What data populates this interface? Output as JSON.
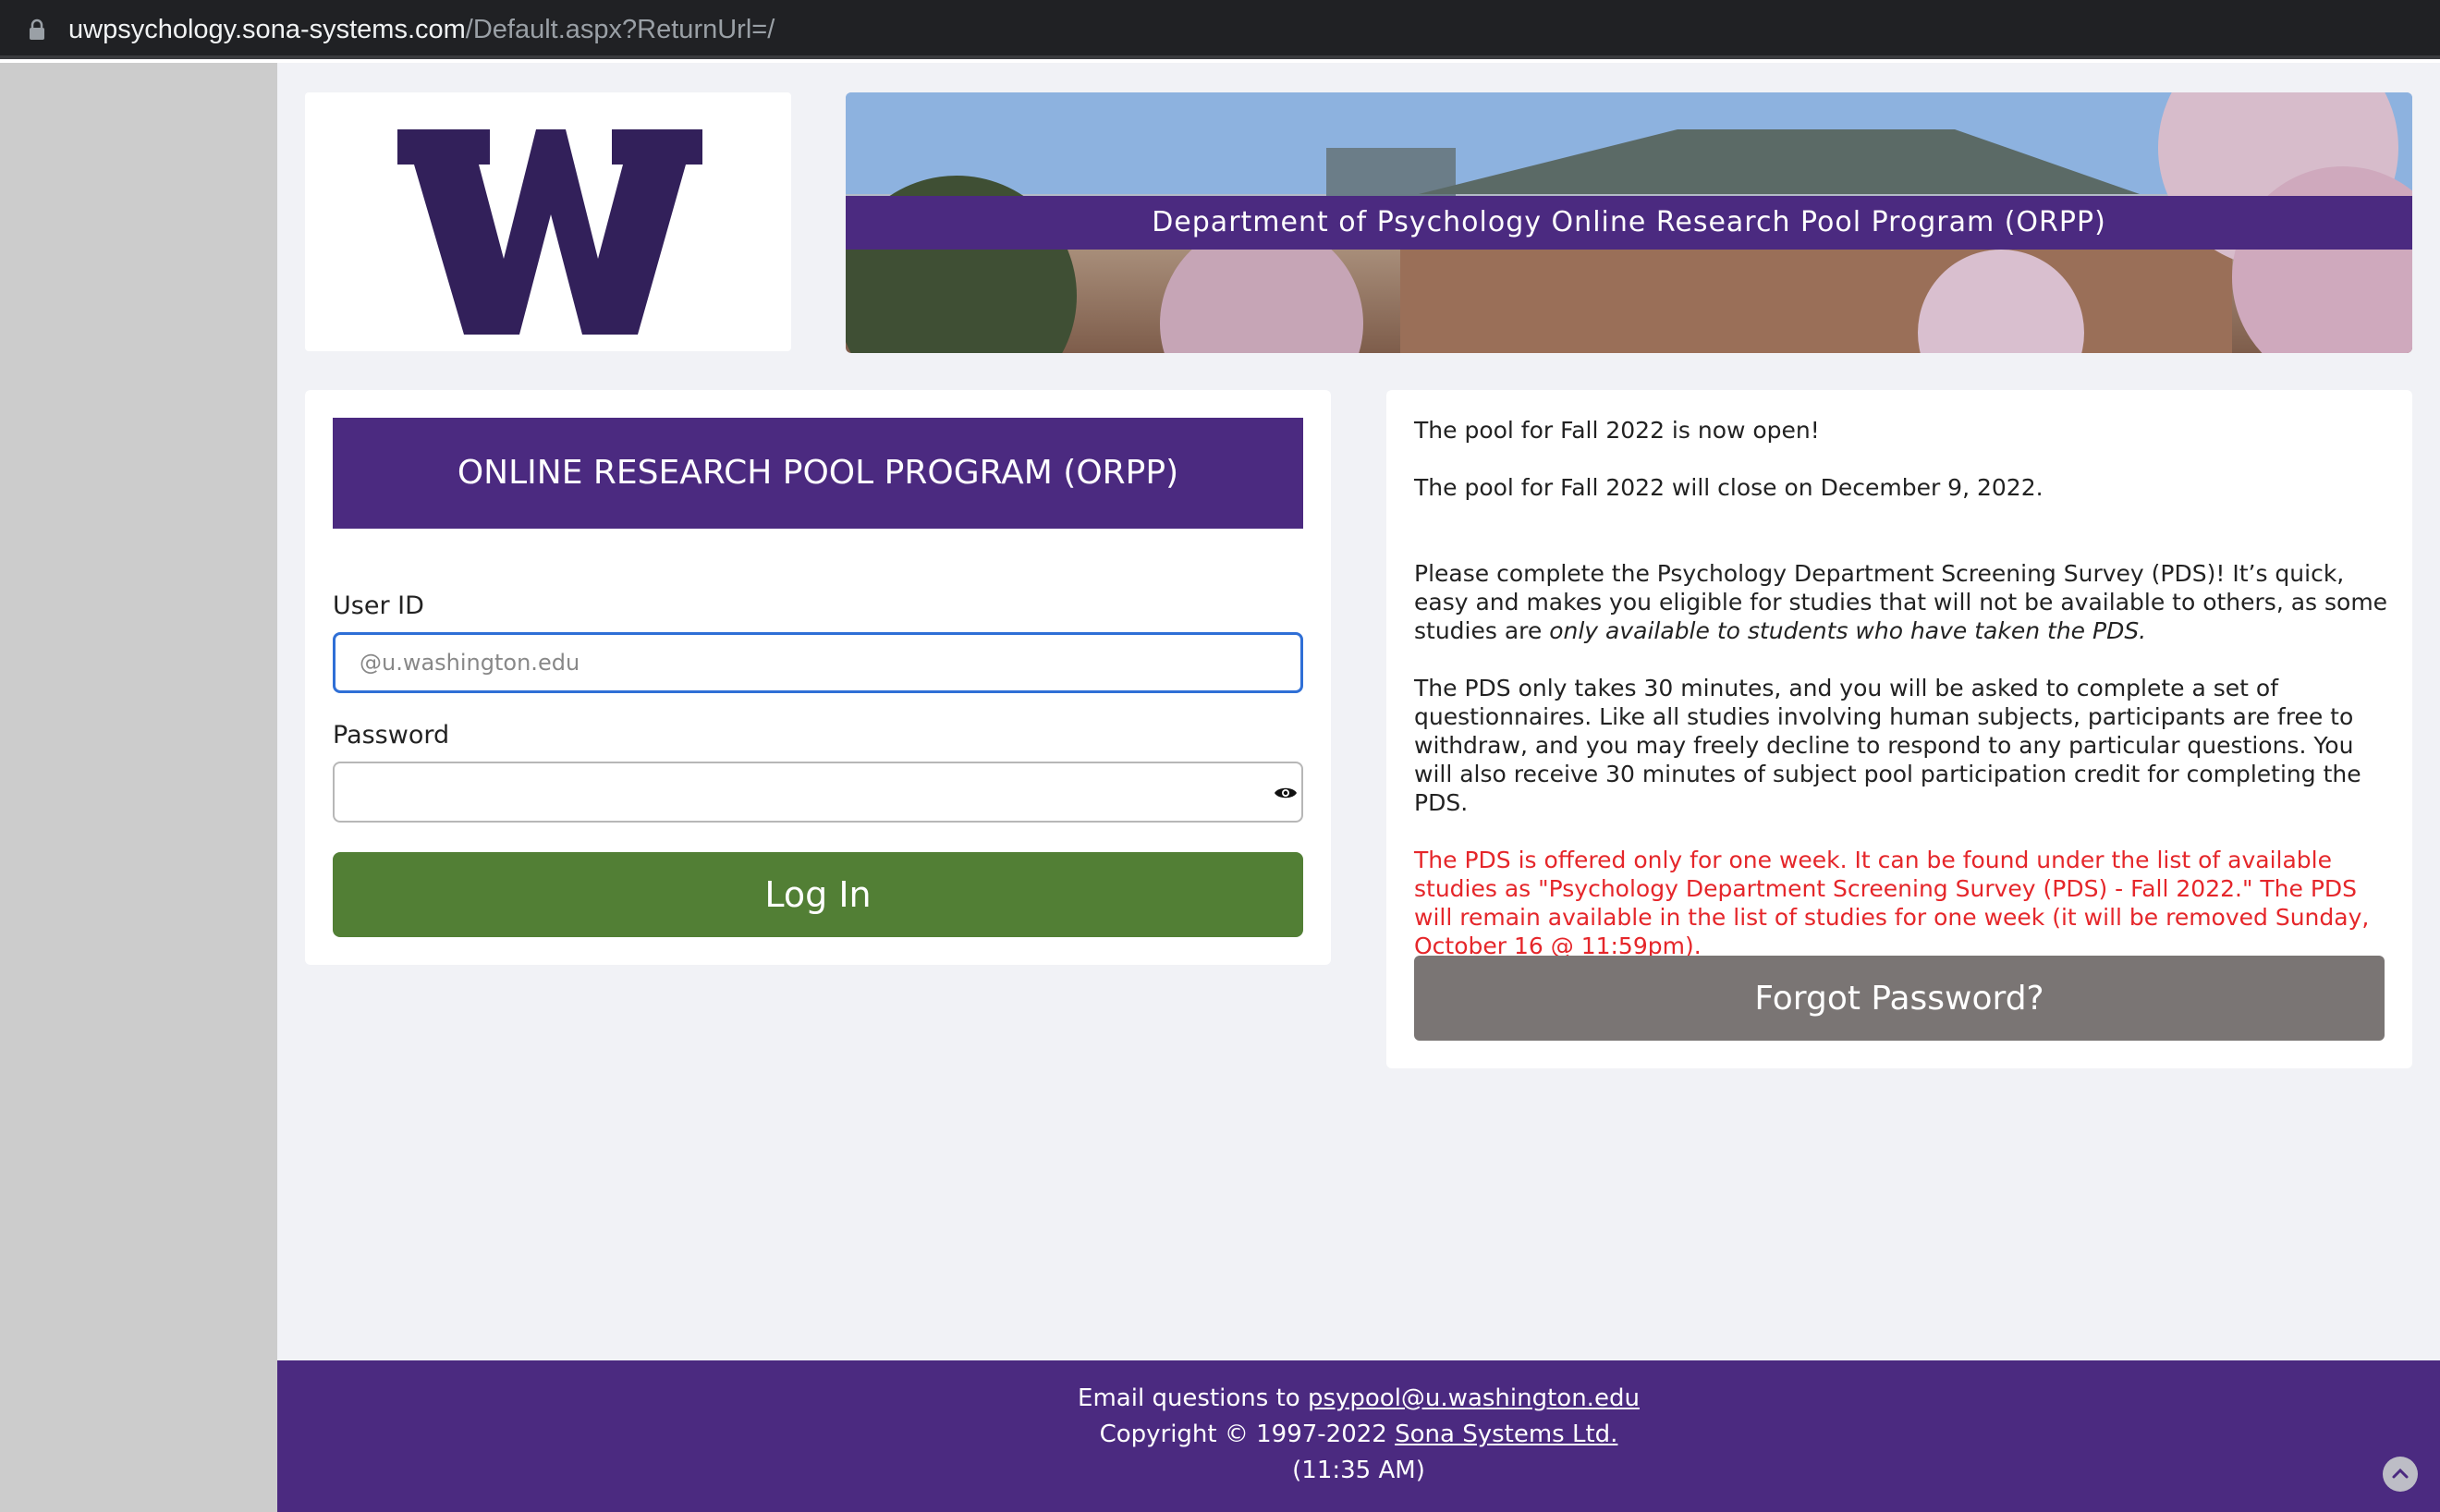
{
  "browser": {
    "url_host": "uwpsychology.sona-systems.com",
    "url_path": "/Default.aspx?ReturnUrl=/"
  },
  "colors": {
    "brand_purple": "#4b2a80",
    "login_green": "#527f35",
    "forgot_gray": "#7a7574",
    "alert_red": "#e5262a"
  },
  "header": {
    "logo_icon": "uw-w-logo-icon",
    "banner_title": "Department of Psychology Online Research Pool Program (ORPP)"
  },
  "login": {
    "title": "ONLINE RESEARCH POOL PROGRAM (ORPP)",
    "user_label": "User ID",
    "user_placeholder": "@u.washington.edu",
    "password_label": "Password",
    "password_value": "",
    "show_password_icon": "eye-icon",
    "login_label": "Log In"
  },
  "info": {
    "line1": "The pool for Fall 2022 is now open!",
    "line2": "The pool for Fall 2022 will close on December 9, 2022.",
    "pds_intro": "Please complete the Psychology Department Screening Survey (PDS)! It’s quick, easy and makes you eligible for studies that will not be available to others, as some studies are ",
    "pds_intro_em": "only available to students who have taken the PDS.",
    "pds_details": "The PDS only takes 30 minutes, and you will be asked to complete a set of questionnaires. Like all studies involving human subjects, participants are free to withdraw, and you may freely decline to respond to any particular questions. You will also receive 30 minutes of subject pool participation credit for completing the PDS.",
    "pds_alert": "The PDS is offered only for one week. It can be found under the list of available studies as \"Psychology Department Screening Survey (PDS) - Fall 2022.\" The PDS will remain available in the list of studies for one week (it will be removed Sunday, October 16 @ 11:59pm).",
    "forgot_label": "Forgot Password?"
  },
  "footer": {
    "email_prefix": "Email questions to ",
    "email_link": "psypool@u.washington.edu",
    "copyright_prefix": "Copyright © 1997-2022 ",
    "copyright_link": "Sona Systems Ltd.",
    "time": "(11:35 AM)",
    "scroll_top_icon": "chevron-up-icon"
  }
}
